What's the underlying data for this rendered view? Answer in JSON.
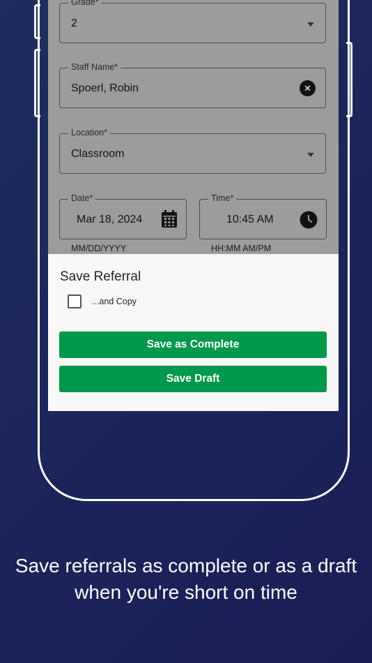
{
  "form": {
    "grade": {
      "label": "Grade*",
      "value": "2"
    },
    "staff_name": {
      "label": "Staff Name*",
      "value": "Spoerl, Robin"
    },
    "location": {
      "label": "Location*",
      "value": "Classroom"
    },
    "date": {
      "label": "Date*",
      "value": "Mar 18, 2024",
      "helper": "MM/DD/YYYY"
    },
    "time": {
      "label": "Time*",
      "value": "10:45 AM",
      "helper": "HH:MM AM/PM"
    }
  },
  "sheet": {
    "title": "Save Referral",
    "copy_label": "...and Copy",
    "save_complete_label": "Save as Complete",
    "save_draft_label": "Save Draft"
  },
  "caption": "Save referrals as complete or as a draft when you're short on time",
  "icons": {
    "clear": "close-circle-icon",
    "dropdown": "chevron-down-icon",
    "calendar": "calendar-icon",
    "clock": "clock-icon"
  },
  "colors": {
    "primary_button": "#00984a",
    "background": "#1b2459"
  }
}
